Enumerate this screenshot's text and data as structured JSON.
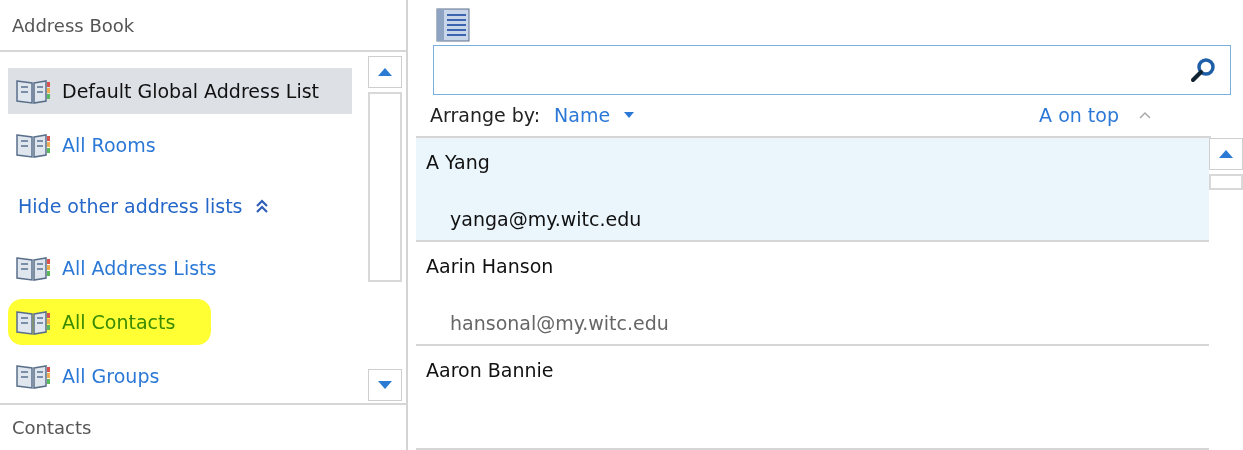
{
  "sidebar": {
    "title": "Address Book",
    "items": [
      {
        "label": "Default Global Address List",
        "selected": true,
        "highlighted": false,
        "kind": "list"
      },
      {
        "label": "All Rooms",
        "selected": false,
        "highlighted": false,
        "kind": "list"
      },
      {
        "label": "Hide other address lists",
        "kind": "toggle",
        "expanded": true
      },
      {
        "label": "All Address Lists",
        "selected": false,
        "highlighted": false,
        "kind": "list"
      },
      {
        "label": "All Contacts",
        "selected": false,
        "highlighted": true,
        "kind": "list"
      },
      {
        "label": "All Groups",
        "selected": false,
        "highlighted": false,
        "kind": "list"
      }
    ],
    "footer": "Contacts"
  },
  "arrange": {
    "label": "Arrange by:",
    "field": "Name",
    "order": "A on top"
  },
  "contacts": [
    {
      "name": "A Yang",
      "email": "yanga@my.witc.edu",
      "selected": true
    },
    {
      "name": "Aarin Hanson",
      "email": "hansonal@my.witc.edu",
      "selected": false
    },
    {
      "name": "Aaron Bannie",
      "selected": false
    }
  ]
}
